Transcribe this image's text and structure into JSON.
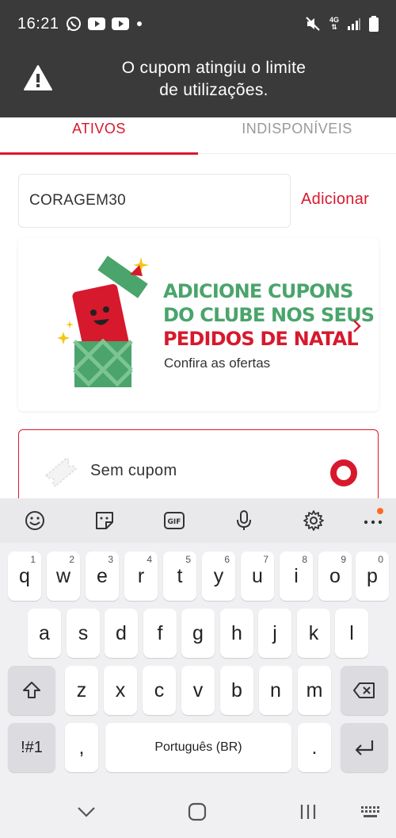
{
  "status_bar": {
    "time": "16:21",
    "network": "4G"
  },
  "toast": {
    "message_line1": "O cupom atingiu o limite",
    "message_line2": "de utilizações."
  },
  "tabs": [
    {
      "label": "ATIVOS",
      "active": true
    },
    {
      "label": "INDISPONÍVEIS",
      "active": false
    }
  ],
  "coupon_form": {
    "input_value": "CORAGEM30",
    "add_label": "Adicionar"
  },
  "promo": {
    "line1": "ADICIONE CUPONS",
    "line2": "DO CLUBE NOS SEUS",
    "line3": "PEDIDOS DE NATAL",
    "subtitle": "Confira as ofertas"
  },
  "no_coupon": {
    "label": "Sem cupom",
    "selected": true
  },
  "keyboard": {
    "row1": [
      {
        "k": "q",
        "n": "1"
      },
      {
        "k": "w",
        "n": "2"
      },
      {
        "k": "e",
        "n": "3"
      },
      {
        "k": "r",
        "n": "4"
      },
      {
        "k": "t",
        "n": "5"
      },
      {
        "k": "y",
        "n": "6"
      },
      {
        "k": "u",
        "n": "7"
      },
      {
        "k": "i",
        "n": "8"
      },
      {
        "k": "o",
        "n": "9"
      },
      {
        "k": "p",
        "n": "0"
      }
    ],
    "row2": [
      "a",
      "s",
      "d",
      "f",
      "g",
      "h",
      "j",
      "k",
      "l"
    ],
    "row3": [
      "z",
      "x",
      "c",
      "v",
      "b",
      "n",
      "m"
    ],
    "symbols_label": "!#1",
    "comma_label": ",",
    "space_label": "Português (BR)",
    "period_label": "."
  },
  "colors": {
    "accent": "#d7192d",
    "promo_green": "#4aa46b",
    "toast_bg": "#3a3a3a"
  }
}
